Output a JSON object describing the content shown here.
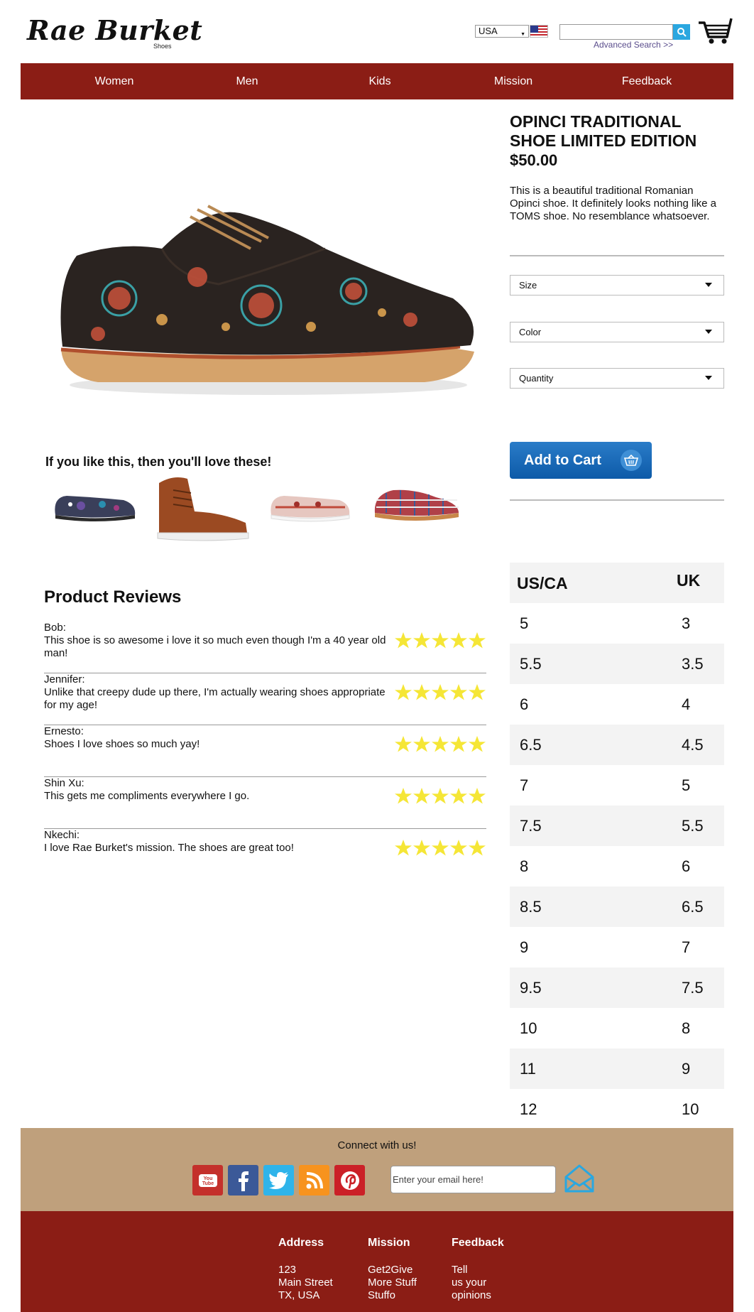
{
  "brand": {
    "name": "Rae Burket",
    "tagline": "Shoes"
  },
  "header": {
    "country": "USA",
    "search_placeholder": "",
    "advanced_search": "Advanced Search >>",
    "accent_color": "#8b1d15"
  },
  "nav": {
    "items": [
      {
        "label": "Women"
      },
      {
        "label": "Men"
      },
      {
        "label": "Kids"
      },
      {
        "label": "Mission"
      },
      {
        "label": "Feedback"
      }
    ]
  },
  "product": {
    "title": "Opinci Traditional Shoe Limited Edition",
    "price": "$50.00",
    "description": "This is a beautiful traditional Romanian Opinci shoe. It definitely looks nothing like a TOMS shoe. No resemblance whatsoever.",
    "selects": [
      {
        "label": "Size"
      },
      {
        "label": "Color"
      },
      {
        "label": "Quantity"
      }
    ],
    "add_to_cart": "Add to Cart"
  },
  "related": {
    "heading": "If you like this, then you'll love these!"
  },
  "reviews": {
    "heading": "Product Reviews",
    "items": [
      {
        "author": "Bob:",
        "text": "This shoe is so awesome i love it so much even though I'm a 40 year old man!",
        "rating": 5
      },
      {
        "author": "Jennifer:",
        "text": "Unlike that creepy dude up there, I'm actually wearing shoes appropriate for my age!",
        "rating": 5
      },
      {
        "author": "Ernesto:",
        "text": "Shoes I love shoes so much yay!",
        "rating": 5
      },
      {
        "author": "Shin Xu:",
        "text": "This gets me compliments everywhere I go.",
        "rating": 5
      },
      {
        "author": "Nkechi:",
        "text": "I love Rae Burket's mission. The shoes are great too!",
        "rating": 5
      }
    ]
  },
  "size_chart": {
    "headers": [
      "US/CA",
      "UK"
    ],
    "rows": [
      [
        "5",
        "3"
      ],
      [
        "5.5",
        "3.5"
      ],
      [
        "6",
        "4"
      ],
      [
        "6.5",
        "4.5"
      ],
      [
        "7",
        "5"
      ],
      [
        "7.5",
        "5.5"
      ],
      [
        "8",
        "6"
      ],
      [
        "8.5",
        "6.5"
      ],
      [
        "9",
        "7"
      ],
      [
        "9.5",
        "7.5"
      ],
      [
        "10",
        "8"
      ],
      [
        "11",
        "9"
      ],
      [
        "12",
        "10"
      ]
    ]
  },
  "connect": {
    "title": "Connect with us!",
    "email_placeholder": "Enter your email here!",
    "social": [
      {
        "icon": "youtube-icon",
        "color": "#c4302b"
      },
      {
        "icon": "facebook-icon",
        "color": "#3b5998"
      },
      {
        "icon": "twitter-icon",
        "color": "#2fb4ea"
      },
      {
        "icon": "rss-icon",
        "color": "#f7931e"
      },
      {
        "icon": "pinterest-icon",
        "color": "#cb2027"
      }
    ]
  },
  "footer": {
    "columns": [
      {
        "heading": "Address",
        "lines": [
          "123",
          "Main Street",
          "TX, USA"
        ]
      },
      {
        "heading": "Mission",
        "lines": [
          "Get2Give",
          "More Stuff",
          "Stuffo"
        ]
      },
      {
        "heading": "Feedback",
        "lines": [
          "Tell",
          "us your",
          "opinions"
        ]
      }
    ]
  }
}
